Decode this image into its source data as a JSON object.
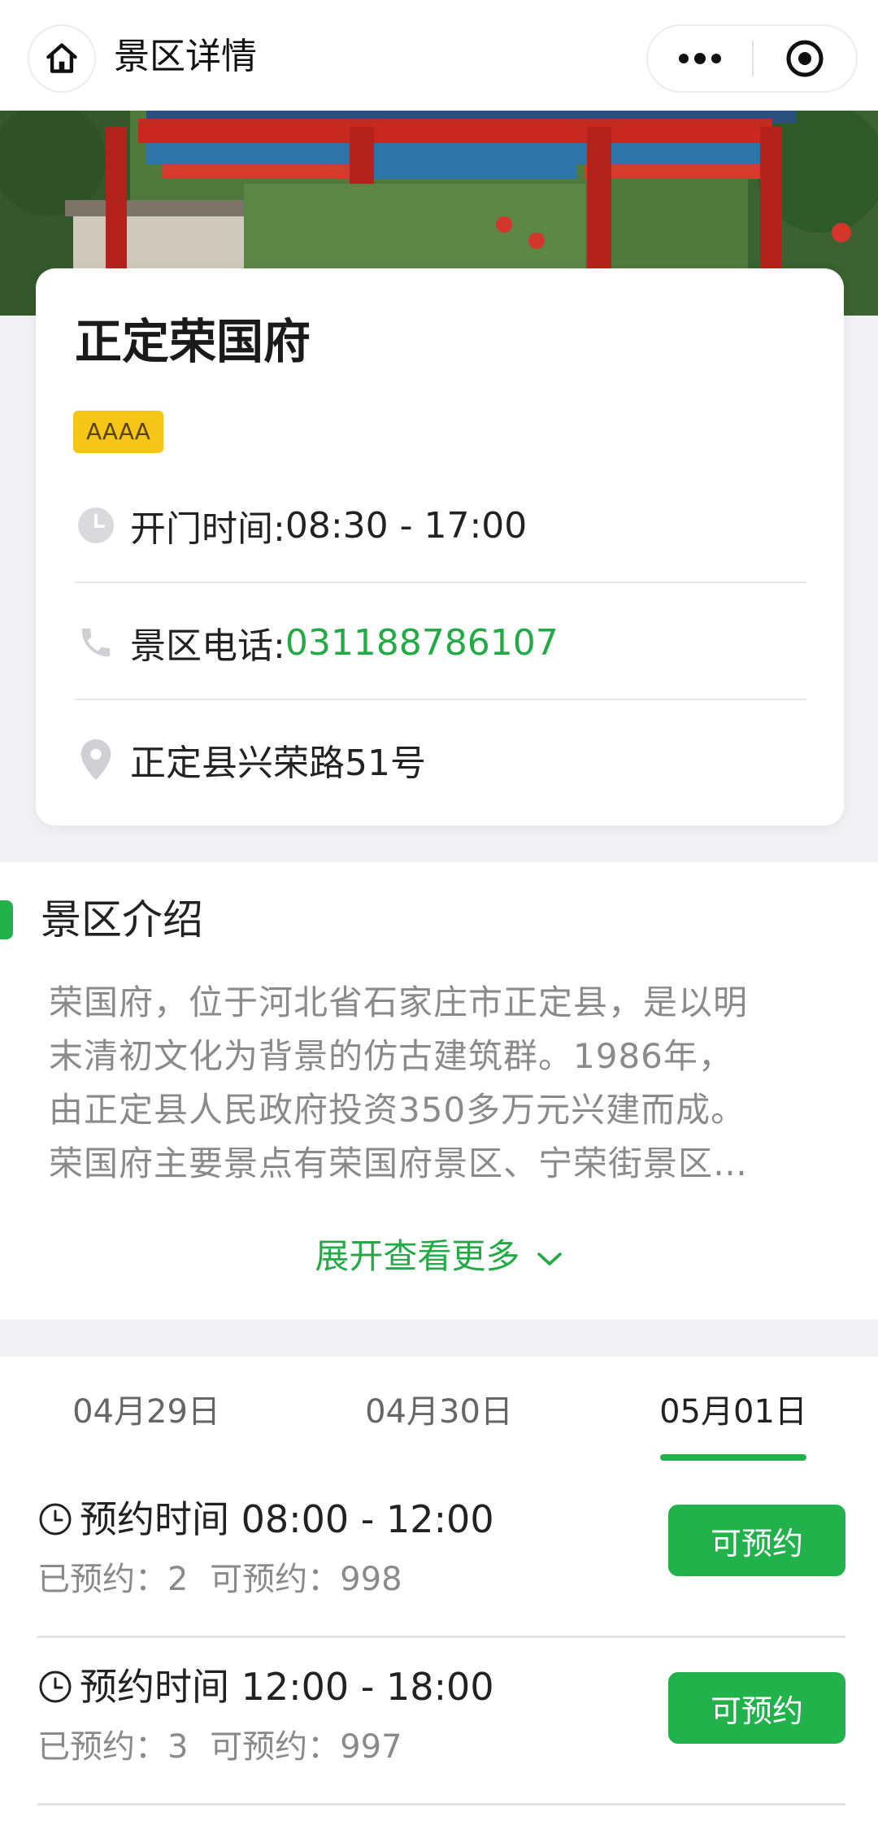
{
  "navbar": {
    "title": "景区详情",
    "home_icon": "home-icon",
    "more_icon": "more-dots-icon",
    "target_icon": "target-icon"
  },
  "scenic": {
    "name": "正定荣国府",
    "level": "AAAA",
    "hours_label": "开门时间: ",
    "hours": "08:30 - 17:00",
    "phone_label": "景区电话: ",
    "phone": "031188786107",
    "address": "正定县兴荣路51号"
  },
  "intro": {
    "title": "景区介绍",
    "lines": [
      "荣国府，位于河北省石家庄市正定县，是以明",
      "末清初文化为背景的仿古建筑群。1986年，",
      "由正定县人民政府投资350多万元兴建而成。",
      "荣国府主要景点有荣国府景区、宁荣街景区…"
    ],
    "expand_label": "展开查看更多"
  },
  "booking": {
    "dates": [
      "04月29日",
      "04月30日",
      "05月01日"
    ],
    "active_date_index": 2,
    "slots": [
      {
        "time_label": "预约时间 08:00 - 12:00",
        "booked_label": "已预约：2",
        "available_label": "可预约：998",
        "button": "可预约"
      },
      {
        "time_label": "预约时间 12:00 - 18:00",
        "booked_label": "已预约：3",
        "available_label": "可预约：997",
        "button": "可预约"
      }
    ]
  },
  "colors": {
    "accent": "#22b24c",
    "level_badge": "#f5c518",
    "muted_text": "#8a8a8a"
  }
}
